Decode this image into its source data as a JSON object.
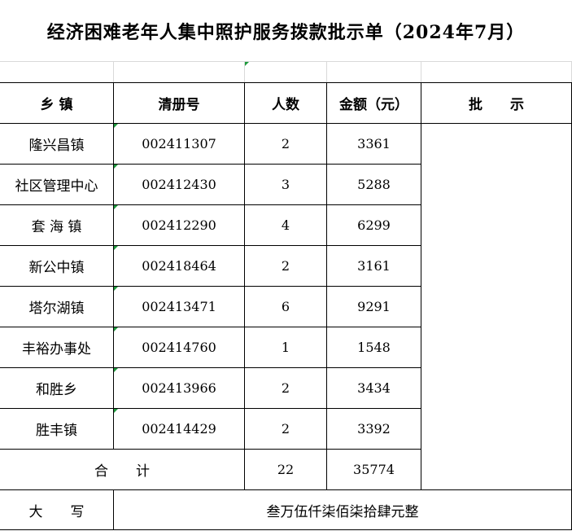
{
  "title": "经济困难老年人集中照护服务拨款批示单（2024年7月）",
  "headers": {
    "town": "乡 镇",
    "register_no": "清册号",
    "people": "人数",
    "amount": "金额（元）",
    "approval": "批　　示"
  },
  "rows": [
    {
      "town": "隆兴昌镇",
      "register_no": "002411307",
      "people": "2",
      "amount": "3361"
    },
    {
      "town": "社区管理中心",
      "register_no": "002412430",
      "people": "3",
      "amount": "5288"
    },
    {
      "town": "套 海 镇",
      "register_no": "002412290",
      "people": "4",
      "amount": "6299"
    },
    {
      "town": "新公中镇",
      "register_no": "002418464",
      "people": "2",
      "amount": "3161"
    },
    {
      "town": "塔尔湖镇",
      "register_no": "002413471",
      "people": "6",
      "amount": "9291"
    },
    {
      "town": "丰裕办事处",
      "register_no": "002414760",
      "people": "1",
      "amount": "1548"
    },
    {
      "town": "和胜乡",
      "register_no": "002413966",
      "people": "2",
      "amount": "3434"
    },
    {
      "town": "胜丰镇",
      "register_no": "002414429",
      "people": "2",
      "amount": "3392"
    }
  ],
  "total": {
    "label": "合　　计",
    "people": "22",
    "amount": "35774"
  },
  "capital": {
    "label": "大　　写",
    "value": "叁万伍仟柒佰柒拾肆元整"
  }
}
